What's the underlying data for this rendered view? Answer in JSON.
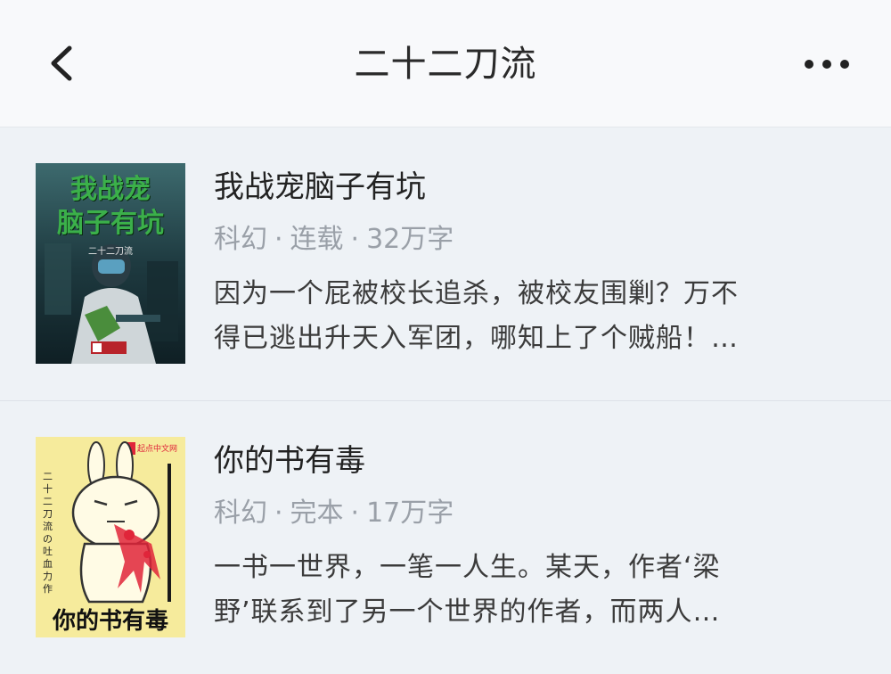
{
  "header": {
    "title": "二十二刀流",
    "back_icon": "chevron-left-icon",
    "more_icon": "more-horizontal-icon"
  },
  "books": [
    {
      "title": "我战宠脑子有坑",
      "category": "科幻",
      "status": "连载",
      "word_count": "32万字",
      "desc_line1": "因为一个屁被校长追杀，被校友围剿？万不",
      "desc_line2": "得已逃出升天入军团，哪知上了个贼船！…",
      "cover": {
        "title_line1": "我战宠",
        "title_line2": "脑子有坑",
        "author": "二十二刀流",
        "title_color": "#2a8f3a",
        "bg_color": "#1f3b43"
      }
    },
    {
      "title": "你的书有毒",
      "category": "科幻",
      "status": "完本",
      "word_count": "17万字",
      "desc_line1": "一书一世界，一笔一人生。某天，作者‘梁",
      "desc_line2": "野’联系到了另一个世界的作者，而两人…",
      "cover": {
        "title": "你的书有毒",
        "publisher": "起点中文网",
        "author_line": "二十二刀流の吐血力作",
        "bg_color": "#f6eb9c",
        "accent_color": "#e0253a"
      }
    }
  ],
  "colors": {
    "header_bg": "#f8f9fb",
    "list_bg": "#eef2f6",
    "meta_text": "#9aa0a8",
    "title_text": "#222222"
  }
}
